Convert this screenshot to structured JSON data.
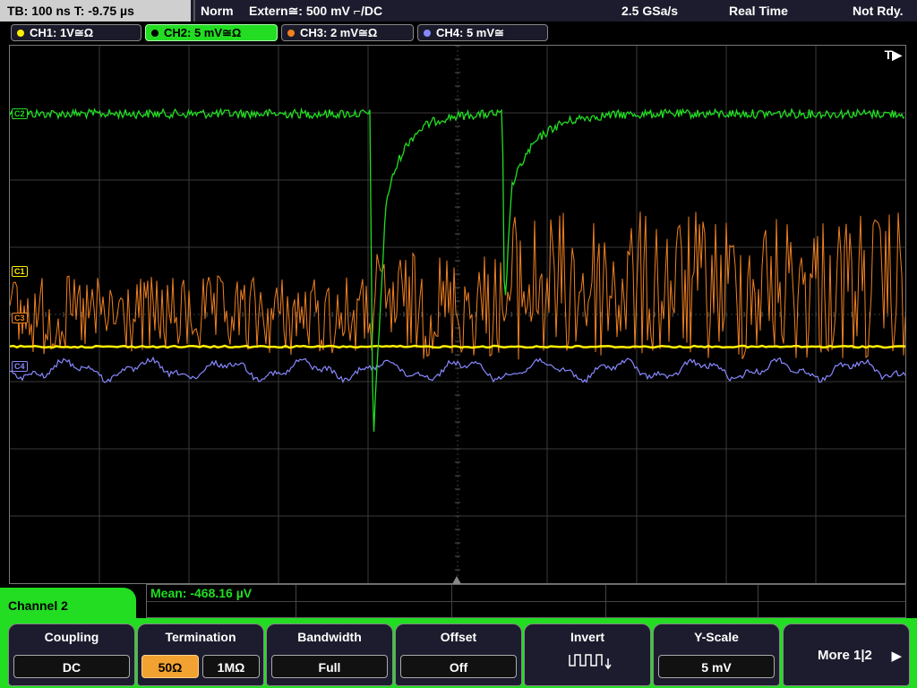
{
  "topbar": {
    "timebase": "TB: 100 ns   T: -9.75 µs",
    "mode": "Norm",
    "trigger": "Extern≅: 500 mV ⌐/DC",
    "sample_rate": "2.5 GSa/s",
    "acq_mode": "Real Time",
    "status": "Not Rdy."
  },
  "channels": [
    {
      "label": "CH1: 1V≅Ω",
      "color": "#ffee00",
      "active": false
    },
    {
      "label": "CH2: 5 mV≅Ω",
      "color": "#22dd22",
      "active": true
    },
    {
      "label": "CH3: 2 mV≅Ω",
      "color": "#f08020",
      "active": false
    },
    {
      "label": "CH4: 5 mV≅",
      "color": "#8888ff",
      "active": false
    }
  ],
  "markers": {
    "trigger": "T▶",
    "c2": "C2",
    "c1": "C1",
    "c3": "C3",
    "c4": "C4"
  },
  "measurement": {
    "mean": "Mean: -468.16 µV"
  },
  "menu": {
    "title": "Channel 2",
    "coupling": {
      "label": "Coupling",
      "value": "DC"
    },
    "termination": {
      "label": "Termination",
      "opt1": "50Ω",
      "opt2": "1MΩ"
    },
    "bandwidth": {
      "label": "Bandwidth",
      "value": "Full"
    },
    "offset": {
      "label": "Offset",
      "value": "Off"
    },
    "invert": {
      "label": "Invert"
    },
    "yscale": {
      "label": "Y-Scale",
      "value": "5 mV"
    },
    "more": {
      "label": "More 1|2",
      "arrow": "▶"
    }
  },
  "colors": {
    "ch1": "#ffee00",
    "ch2": "#22dd22",
    "ch3": "#f08020",
    "ch4": "#8888ff",
    "menu_accent": "#22dd22",
    "selected_option": "#f2a230"
  }
}
